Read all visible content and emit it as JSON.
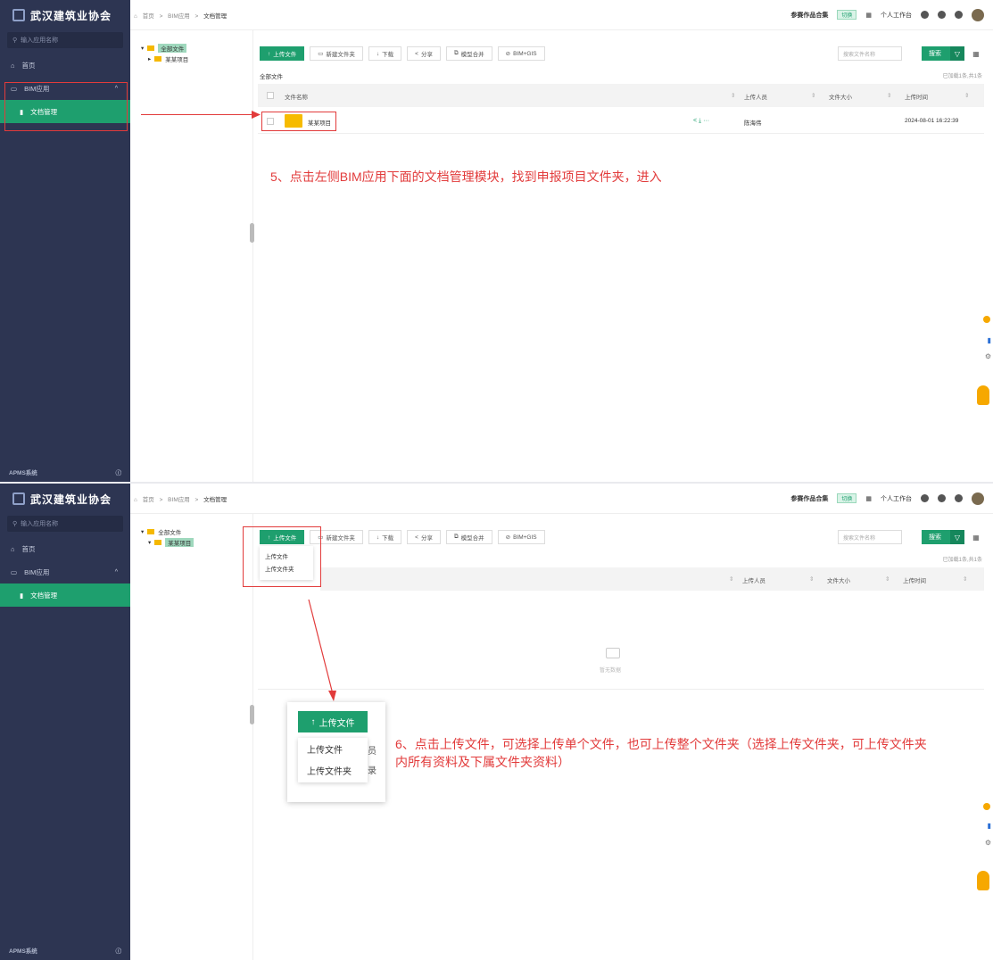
{
  "app": {
    "title": "武汉建筑业协会",
    "search_placeholder": "输入应用名称",
    "nav": {
      "home": "首页",
      "bim": "BIM应用",
      "doc": "文档管理"
    },
    "footer_logo": "APMS系统",
    "footer_icon": "ⓘ"
  },
  "topbar": {
    "crumb_home": "首页",
    "crumb_sep1": ">",
    "crumb_bim": "BIM应用",
    "crumb_sep2": ">",
    "crumb_doc": "文档管理",
    "collection": "参赛作品合集",
    "badge": "切换",
    "workspace": "个人工作台"
  },
  "tree": {
    "root": "全部文件",
    "child": "某某项目"
  },
  "toolbar": {
    "upload": "上传文件",
    "new_folder": "新建文件夹",
    "download": "下载",
    "share": "分享",
    "merge": "模型合并",
    "gis": "BIM+GIS",
    "search_placeholder": "搜索文件名称",
    "search": "搜索"
  },
  "list": {
    "path": "全部文件",
    "count": "已加载1条,共1条",
    "col_name": "文件名称",
    "col_uploader": "上传人员",
    "col_size": "文件大小",
    "col_time": "上传时间",
    "rows": [
      {
        "name": "某某项目",
        "uploader": "陈海伟",
        "size": "",
        "time": "2024-08-01 16:22:39"
      }
    ],
    "empty": "暂无数据"
  },
  "upload_menu": {
    "file": "上传文件",
    "folder": "上传文件夹"
  },
  "annotations": {
    "step5": "5、点击左侧BIM应用下面的文档管理模块，找到申报项目文件夹，进入",
    "step6": "6、点击上传文件，可选择上传单个文件，也可上传整个文件夹（选择上传文件夹，可上传文件夹内所有资料及下属文件夹资料）",
    "zoom_tail1": "员",
    "zoom_tail2": "录"
  },
  "colors": {
    "accent": "#1e9f6e",
    "sidebar": "#2d3552",
    "annotation": "#e23b3b",
    "folder": "#f6bb00"
  }
}
